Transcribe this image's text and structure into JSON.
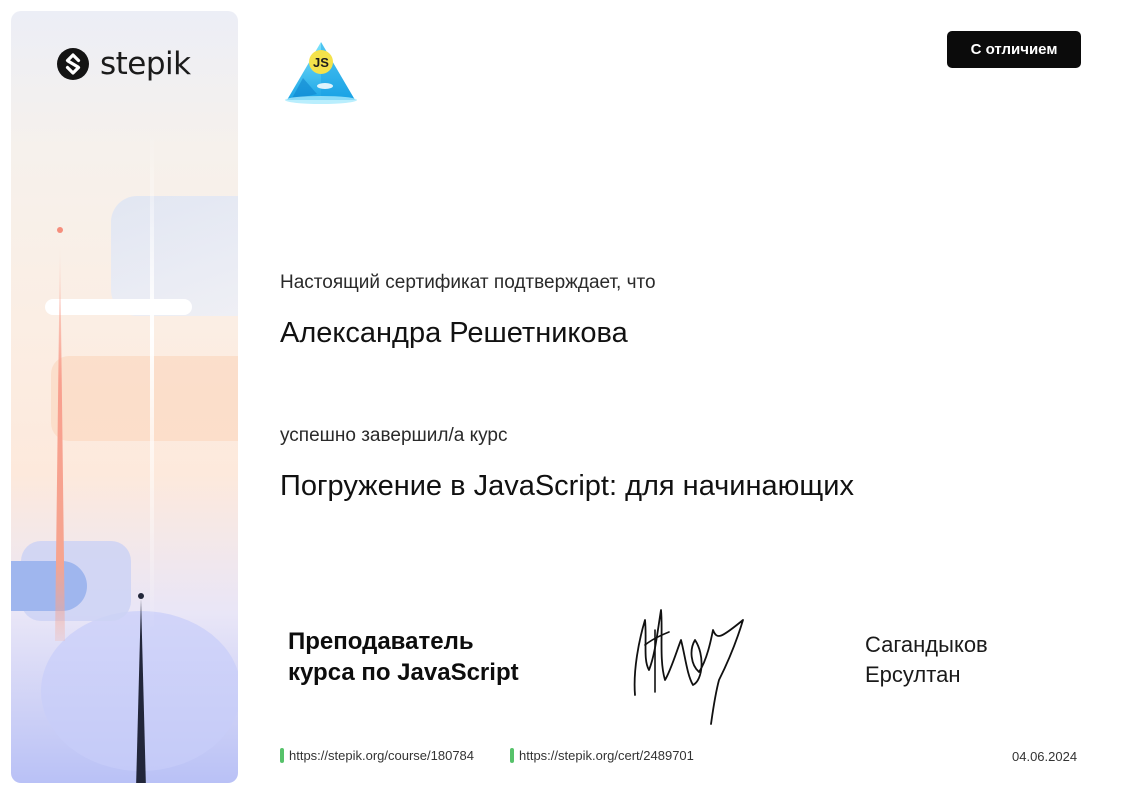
{
  "brand": {
    "name": "stepik"
  },
  "badge": {
    "label": "С отличием"
  },
  "course_icon": {
    "label": "JS"
  },
  "certificate": {
    "confirm_text": "Настоящий сертификат подтверждает, что",
    "recipient_name": "Александра Решетникова",
    "completed_text": "успешно завершил/а  курс",
    "course_title": "Погружение в JavaScript: для начинающих"
  },
  "teacher": {
    "role_line1": "Преподаватель",
    "role_line2": "курса по JavaScript",
    "first_name_line": "Сагандыков",
    "last_name_line": "Ерсултан"
  },
  "footer": {
    "course_url": "https://stepik.org/course/180784",
    "cert_url": "https://stepik.org/cert/2489701",
    "date": "04.06.2024"
  },
  "colors": {
    "badge_bg": "#0b0b0b",
    "link_marker": "#56c26a",
    "course_icon_primary": "#2ec7ef"
  }
}
